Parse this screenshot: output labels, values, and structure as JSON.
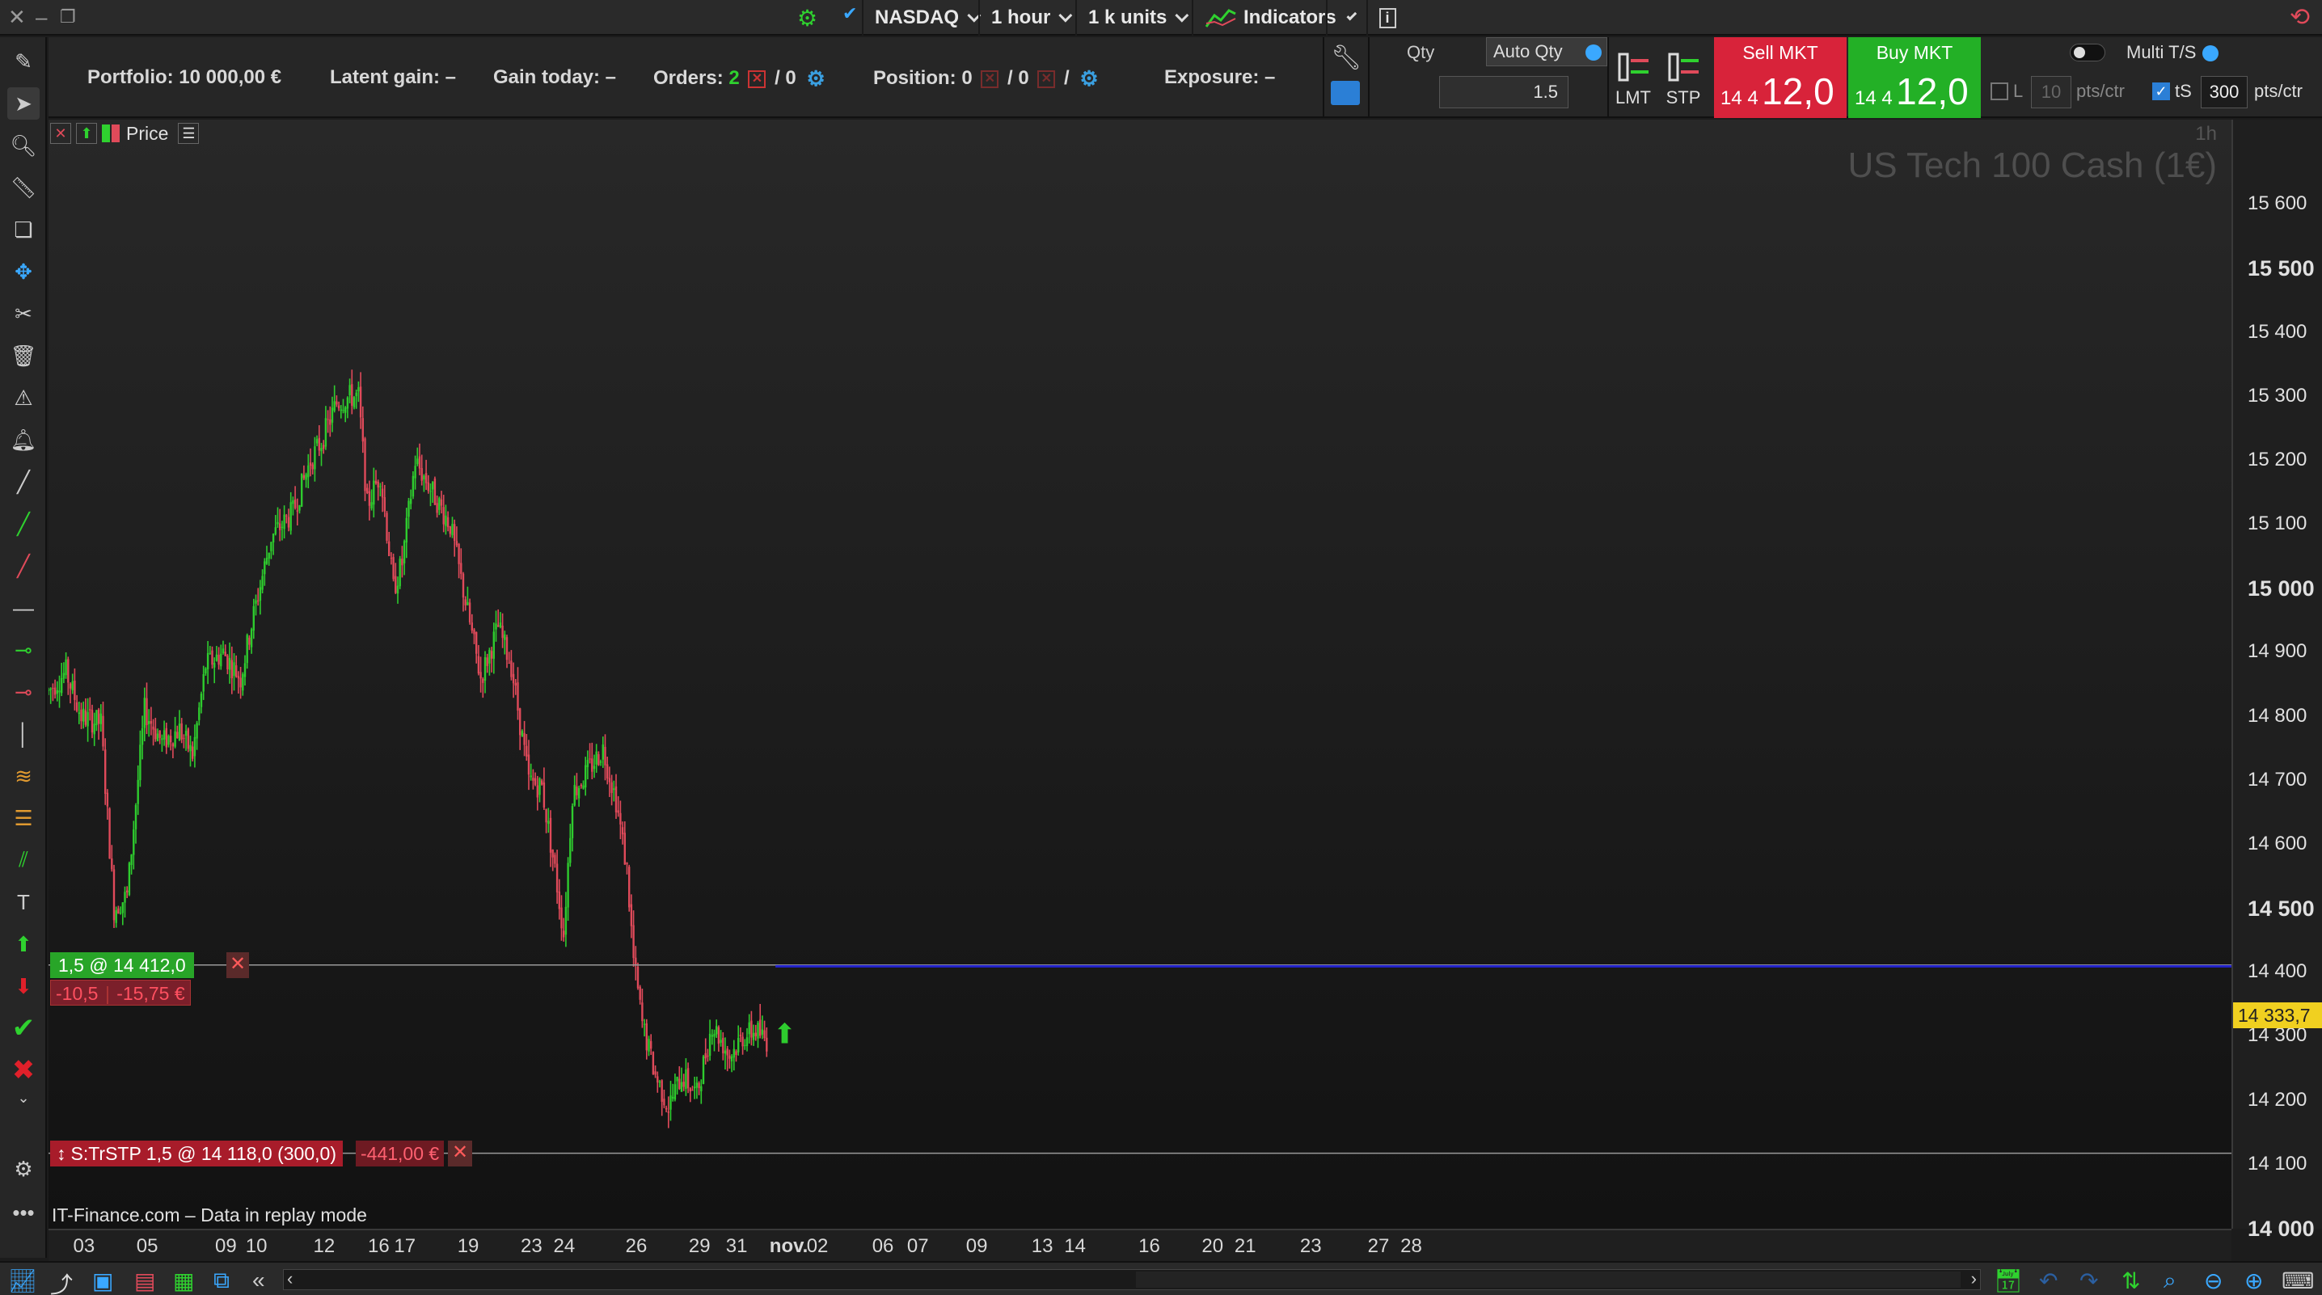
{
  "toolbar": {
    "exchange": "NASDAQ",
    "timeframe": "1 hour",
    "units": "1 k units",
    "indicators": "Indicators",
    "info": "i"
  },
  "account": {
    "portfolio": "Portfolio: 10 000,00 €",
    "latent_gain": "Latent gain: –",
    "gain_today": "Gain today: –",
    "orders_label": "Orders:",
    "orders_count": "2",
    "orders_second": "/ 0",
    "position_label": "Position: 0",
    "position_second": "/ 0",
    "position_slash": "/",
    "exposure": "Exposure: –"
  },
  "ticket": {
    "qty_label": "Qty",
    "auto_qty_label": "Auto Qty",
    "qty_value": "1.5",
    "lmt_label": "LMT",
    "stp_label": "STP",
    "sell_label": "Sell MKT",
    "sell_price_small": "14 4",
    "sell_price_big": "12,0",
    "buy_label": "Buy MKT",
    "buy_price_small": "14 4",
    "buy_price_big": "12,0",
    "multi_ts": "Multi T/S",
    "limit_label": "L",
    "limit_value": "10",
    "trailing_label": "tS",
    "trailing_value": "300",
    "pts_ctr": "pts/ctr",
    "pts_ctr2": "pts/ctr"
  },
  "chart": {
    "header_label": "Price",
    "timeframe_label": "1h",
    "instrument": "US Tech 100 Cash (1€)",
    "replay_note": "IT-Finance.com – Data in replay mode",
    "position_tag": "1,5 @ 14 412,0",
    "pnl_points": "-10,5",
    "pnl_money": "-15,75 €",
    "stop_tag": "S:TrSTP 1,5 @ 14 118,0 (300,0)",
    "stop_pnl": "-441,00 €",
    "last_price": "14 333,7"
  },
  "colors": {
    "up": "#2ecc2e",
    "down": "#e04a5a",
    "sell": "#d8233a",
    "buy": "#23b026",
    "entry_line": "#2222cc",
    "last_price": "#f0d020"
  },
  "chart_data": {
    "type": "candlestick",
    "title": "US Tech 100 Cash (1€)",
    "timeframe": "1h",
    "ylim": [
      14000,
      15700
    ],
    "y_ticks": [
      "15 600",
      "15 500",
      "15 400",
      "15 300",
      "15 200",
      "15 100",
      "15 000",
      "14 900",
      "14 800",
      "14 700",
      "14 600",
      "14 500",
      "14 400",
      "14 300",
      "14 200",
      "14 100",
      "14 000"
    ],
    "y_tick_values": [
      15600,
      15500,
      15400,
      15300,
      15200,
      15100,
      15000,
      14900,
      14800,
      14700,
      14600,
      14500,
      14400,
      14300,
      14200,
      14100,
      14000
    ],
    "x_ticks": [
      "03",
      "05",
      "09",
      "10",
      "12",
      "16",
      "17",
      "19",
      "23",
      "24",
      "26",
      "29",
      "31",
      "nov.",
      "02",
      "06",
      "07",
      "09",
      "13",
      "14",
      "16",
      "20",
      "21",
      "23",
      "27",
      "28"
    ],
    "x_tick_index": [
      15,
      44,
      80,
      94,
      125,
      150,
      162,
      191,
      220,
      235,
      268,
      297,
      314,
      334,
      351,
      381,
      397,
      424,
      454,
      469,
      503,
      532,
      547,
      577,
      608,
      623
    ],
    "n_bars": 330,
    "path": [
      [
        0,
        14840
      ],
      [
        8,
        14870
      ],
      [
        15,
        14800
      ],
      [
        24,
        14790
      ],
      [
        30,
        14500
      ],
      [
        36,
        14520
      ],
      [
        44,
        14810
      ],
      [
        52,
        14760
      ],
      [
        60,
        14780
      ],
      [
        66,
        14740
      ],
      [
        72,
        14880
      ],
      [
        80,
        14900
      ],
      [
        88,
        14860
      ],
      [
        94,
        14960
      ],
      [
        102,
        15080
      ],
      [
        112,
        15120
      ],
      [
        120,
        15200
      ],
      [
        125,
        15230
      ],
      [
        132,
        15290
      ],
      [
        138,
        15300
      ],
      [
        142,
        15300
      ],
      [
        146,
        15130
      ],
      [
        152,
        15180
      ],
      [
        158,
        15000
      ],
      [
        162,
        15040
      ],
      [
        168,
        15200
      ],
      [
        176,
        15150
      ],
      [
        184,
        15100
      ],
      [
        191,
        14980
      ],
      [
        198,
        14860
      ],
      [
        206,
        14940
      ],
      [
        212,
        14880
      ],
      [
        220,
        14700
      ],
      [
        226,
        14690
      ],
      [
        232,
        14560
      ],
      [
        236,
        14460
      ],
      [
        240,
        14680
      ],
      [
        248,
        14720
      ],
      [
        254,
        14750
      ],
      [
        260,
        14670
      ],
      [
        265,
        14560
      ],
      [
        268,
        14420
      ],
      [
        272,
        14320
      ],
      [
        278,
        14240
      ],
      [
        284,
        14190
      ],
      [
        290,
        14240
      ],
      [
        297,
        14210
      ],
      [
        304,
        14320
      ],
      [
        312,
        14270
      ],
      [
        318,
        14300
      ],
      [
        324,
        14310
      ],
      [
        330,
        14290
      ]
    ],
    "lines": {
      "position_entry": 14412.0,
      "entry_price_line": 14410.0,
      "trailing_stop": 14118.0,
      "last_price": 14333.7
    }
  }
}
